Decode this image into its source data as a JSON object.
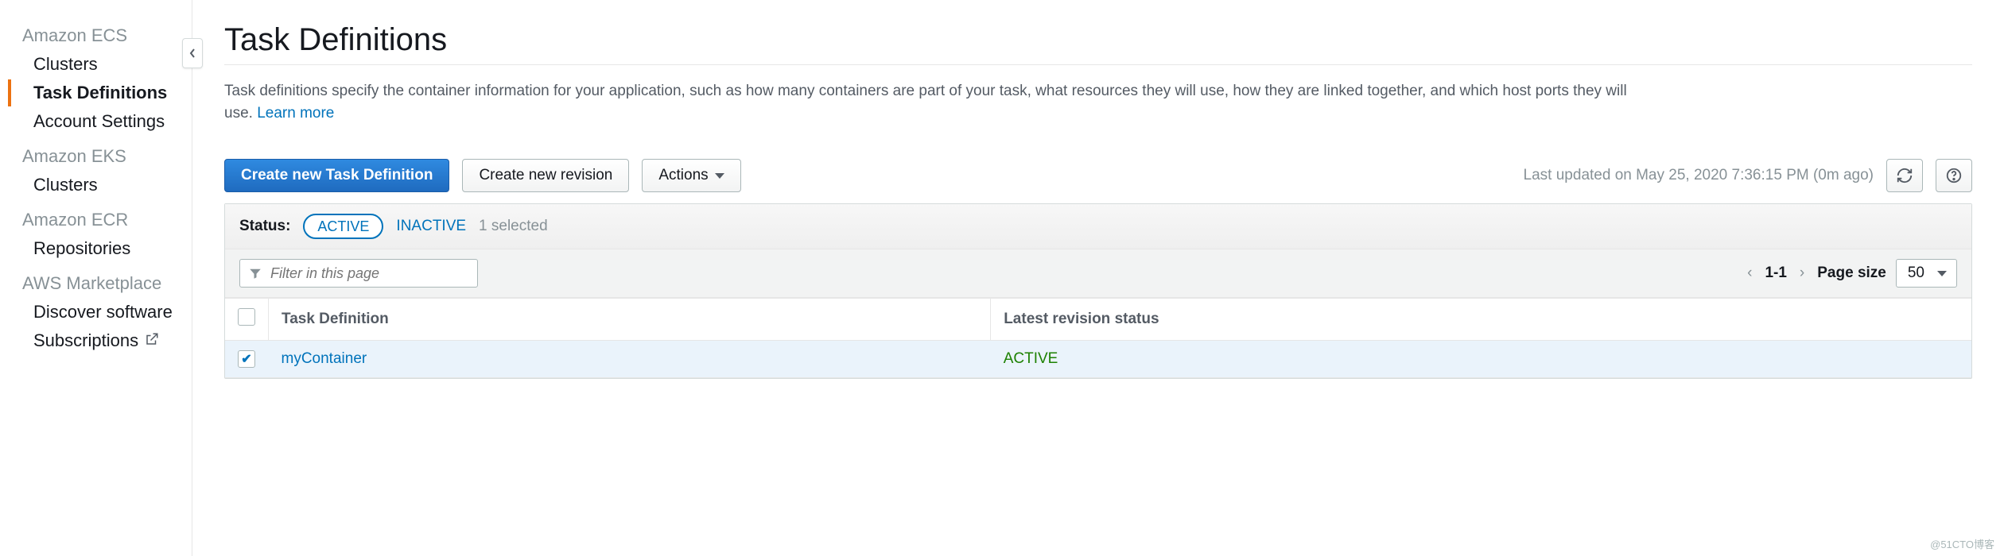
{
  "sidebar": {
    "sections": [
      {
        "title": "Amazon ECS",
        "items": [
          {
            "label": "Clusters",
            "active": false
          },
          {
            "label": "Task Definitions",
            "active": true
          },
          {
            "label": "Account Settings",
            "active": false
          }
        ]
      },
      {
        "title": "Amazon EKS",
        "items": [
          {
            "label": "Clusters",
            "active": false
          }
        ]
      },
      {
        "title": "Amazon ECR",
        "items": [
          {
            "label": "Repositories",
            "active": false
          }
        ]
      },
      {
        "title": "AWS Marketplace",
        "items": [
          {
            "label": "Discover software",
            "active": false
          },
          {
            "label": "Subscriptions",
            "active": false,
            "external": true
          }
        ]
      }
    ]
  },
  "page": {
    "title": "Task Definitions",
    "description": "Task definitions specify the container information for your application, such as how many containers are part of your task, what resources they will use, how they are linked together, and which host ports they will use. ",
    "learn_more": "Learn more"
  },
  "toolbar": {
    "create_task_def": "Create new Task Definition",
    "create_revision": "Create new revision",
    "actions": "Actions",
    "last_updated": "Last updated on May 25, 2020 7:36:15 PM (0m ago)"
  },
  "status_bar": {
    "label": "Status:",
    "active_pill": "ACTIVE",
    "inactive_link": "INACTIVE",
    "selected_text": "1 selected"
  },
  "filter": {
    "placeholder": "Filter in this page"
  },
  "pagination": {
    "range": "1-1",
    "page_size_label": "Page size",
    "page_size_value": "50"
  },
  "table": {
    "columns": {
      "task_def": "Task Definition",
      "latest_rev": "Latest revision status"
    },
    "rows": [
      {
        "name": "myContainer",
        "status": "ACTIVE",
        "checked": true
      }
    ]
  },
  "watermark": "@51CTO博客"
}
